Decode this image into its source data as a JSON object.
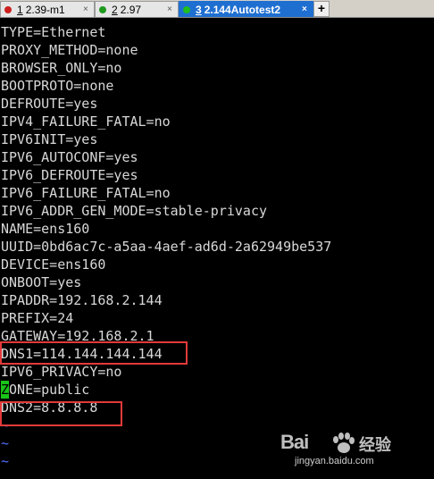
{
  "tabs": [
    {
      "num": "1",
      "label": "2.39-m1",
      "dot_color": "#cc1f1f",
      "active": false
    },
    {
      "num": "2",
      "label": "2.97",
      "dot_color": "#1f9a1f",
      "active": false
    },
    {
      "num": "3",
      "label": "2.144Autotest2",
      "dot_color": "#1fbf1f",
      "active": true
    }
  ],
  "tab_close_glyph": "×",
  "new_tab_glyph": "+",
  "terminal": {
    "lines": [
      "TYPE=Ethernet",
      "PROXY_METHOD=none",
      "BROWSER_ONLY=no",
      "BOOTPROTO=none",
      "DEFROUTE=yes",
      "IPV4_FAILURE_FATAL=no",
      "IPV6INIT=yes",
      "IPV6_AUTOCONF=yes",
      "IPV6_DEFROUTE=yes",
      "IPV6_FAILURE_FATAL=no",
      "IPV6_ADDR_GEN_MODE=stable-privacy",
      "NAME=ens160",
      "UUID=0bd6ac7c-a5aa-4aef-ad6d-2a62949be537",
      "DEVICE=ens160",
      "ONBOOT=yes",
      "IPADDR=192.168.2.144",
      "PREFIX=24",
      "GATEWAY=192.168.2.1",
      "DNS1=114.144.144.144",
      "IPV6_PRIVACY=no"
    ],
    "cursor_char": "Z",
    "cursor_line_rest": "ONE=public",
    "after_lines": [
      "DNS2=8.8.8.8"
    ],
    "tilde_lines": [
      "~",
      "~",
      "~"
    ],
    "cursor_color": "#18c418",
    "highlight_color": "#e23a3a"
  },
  "watermark": {
    "brand": "Bai",
    "brand_cn": "经验",
    "url": "jingyan.baidu.com"
  }
}
